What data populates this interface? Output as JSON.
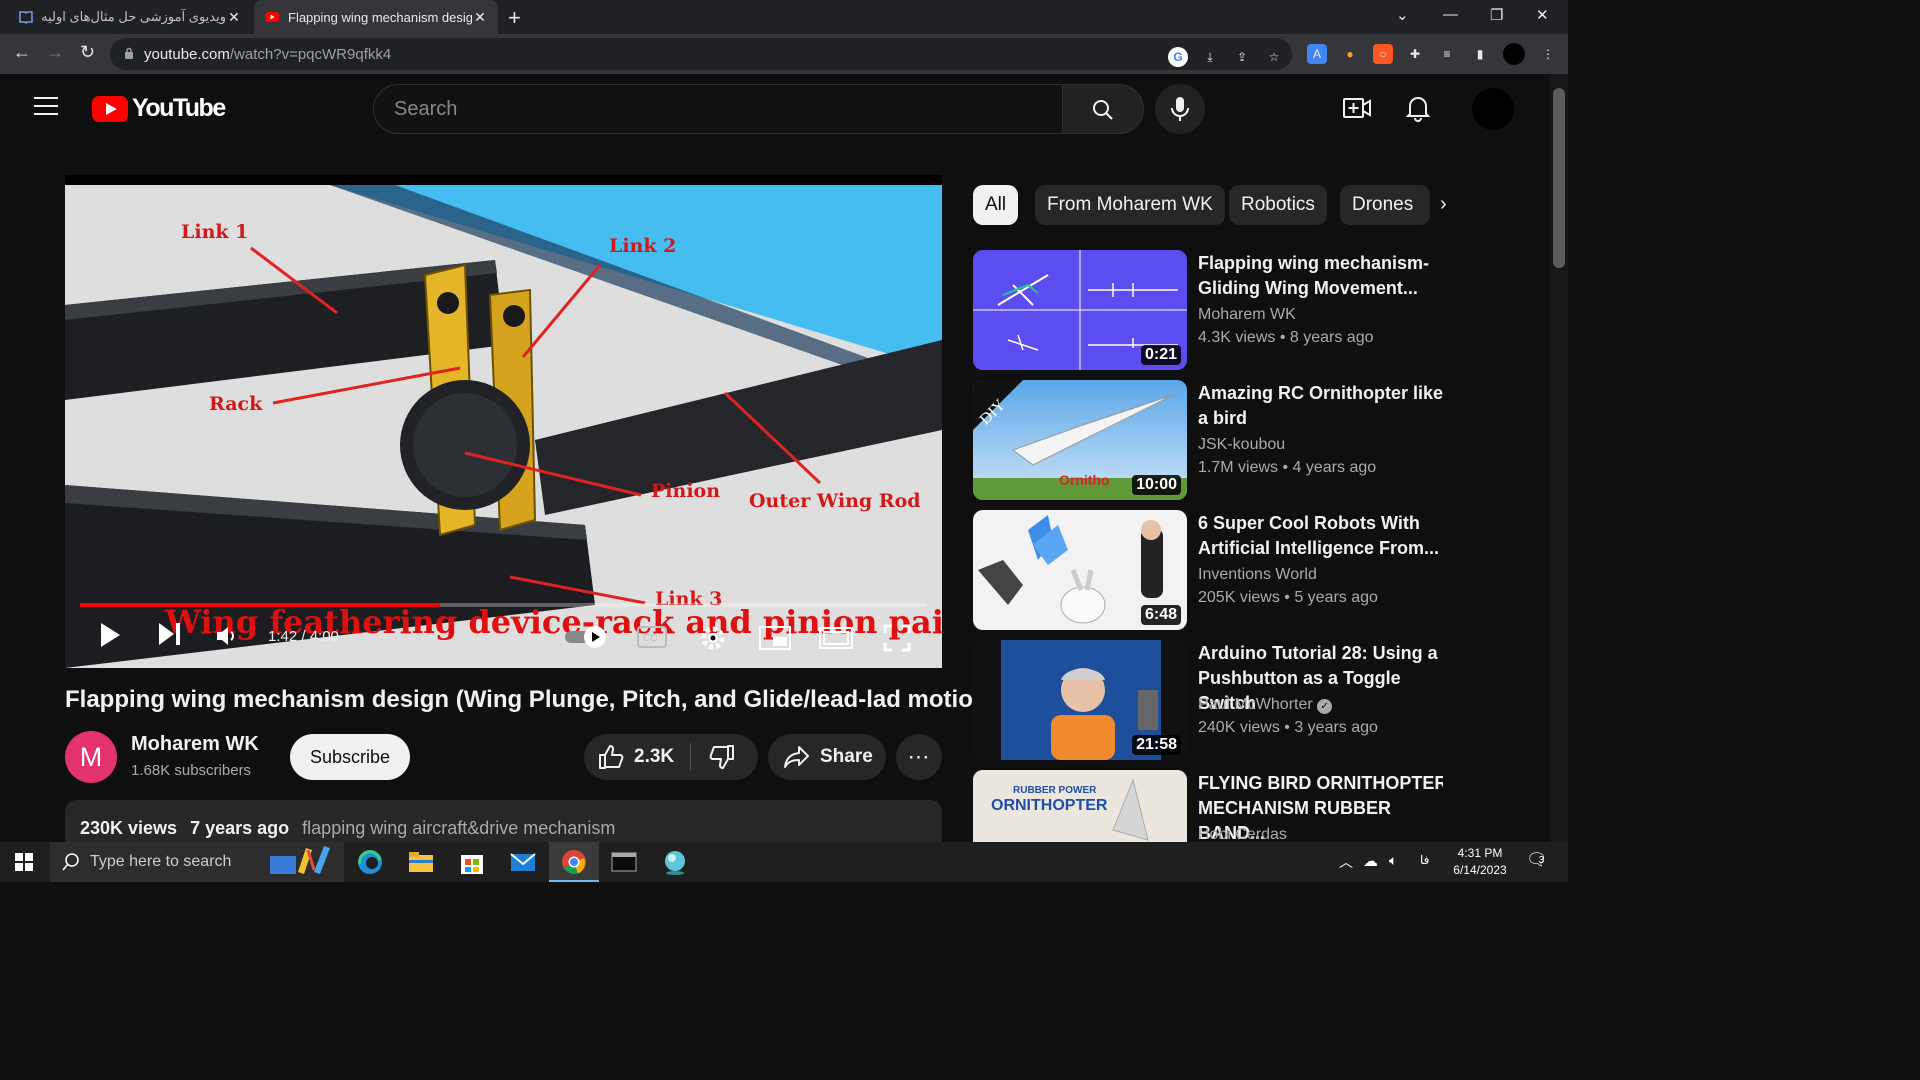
{
  "browser": {
    "tabs": [
      {
        "title": "ویدیوی آموزشی حل مثال‌های اولیه"
      },
      {
        "title": "Flapping wing mechanism design"
      }
    ],
    "url_host": "youtube.com",
    "url_path": "/watch?v=pqcWR9qfkk4"
  },
  "header": {
    "logo_text": "YouTube",
    "search_placeholder": "Search"
  },
  "player": {
    "time": "1:42 / 4:00",
    "progress": 0.425,
    "labels": {
      "link1": "Link 1",
      "link2": "Link 2",
      "rack": "Rack",
      "pinion": "Pinion",
      "outer_wing_rod": "Outer Wing Rod",
      "link3": "Link 3"
    },
    "overlay_title": "Wing feathering device-rack and pinion pair"
  },
  "video": {
    "title": "Flapping wing mechanism design (Wing Plunge, Pitch, and Glide/lead-lad motion)",
    "channel_initial": "M",
    "channel": "Moharem WK",
    "subscribers": "1.68K subscribers",
    "subscribe_label": "Subscribe",
    "likes": "2.3K",
    "share_label": "Share",
    "views": "230K views",
    "age": "7 years ago",
    "tags": "flapping wing aircraft&drive mechanism"
  },
  "chips": [
    "All",
    "From Moharem WK",
    "Robotics",
    "Drones"
  ],
  "related": [
    {
      "title": "Flapping wing mechanism- Gliding Wing Movement...",
      "channel": "Moharem WK",
      "views": "4.3K views",
      "age": "8 years ago",
      "duration": "0:21",
      "verified": false
    },
    {
      "title": "Amazing RC Ornithopter like a bird",
      "channel": "JSK-koubou",
      "views": "1.7M views",
      "age": "4 years ago",
      "duration": "10:00",
      "verified": false,
      "thumb_text": "DIY",
      "thumb_brand": "Ornitho"
    },
    {
      "title": "6 Super Cool Robots With Artificial Intelligence From...",
      "channel": "Inventions World",
      "views": "205K views",
      "age": "5 years ago",
      "duration": "6:48",
      "verified": false
    },
    {
      "title": "Arduino Tutorial 28: Using a Pushbutton as a Toggle Switch",
      "channel": "Paul McWhorter",
      "views": "240K views",
      "age": "3 years ago",
      "duration": "21:58",
      "verified": true
    },
    {
      "title": "FLYING BIRD ORNITHOPTER MECHANISM RUBBER BAND...",
      "channel": "Hobi Cerdas",
      "thumb_text1": "RUBBER POWER",
      "thumb_text2": "ORNITHOPTER"
    }
  ],
  "taskbar": {
    "search_placeholder": "Type here to search",
    "time": "4:31 PM",
    "date": "6/14/2023",
    "lang": "فا",
    "notifications": "3"
  }
}
